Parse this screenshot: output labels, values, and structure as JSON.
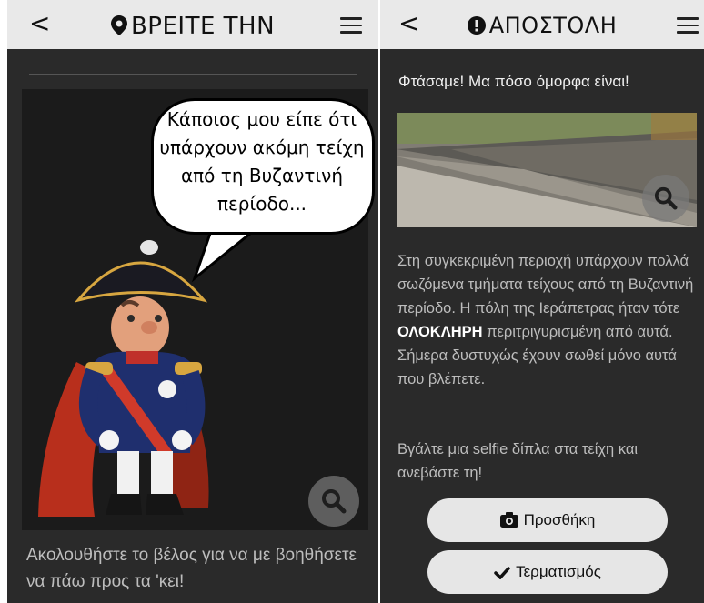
{
  "left_screen": {
    "header": {
      "back_label": "<",
      "title": "ΒΡΕΙΤΕ ΤΗΝ",
      "title_icon": "map-marker-icon",
      "menu_icon": "hamburger-menu-icon"
    },
    "speech_bubble": {
      "text": "Κάποιος μου είπε ότι υπάρχουν ακόμη τείχη από τη Βυζαντινή περίοδο..."
    },
    "zoom_icon": "magnifier-icon",
    "caption": "Ακολουθήστε το βέλος για να με βοηθήσετε να πάω προς τα 'κει!"
  },
  "right_screen": {
    "header": {
      "back_label": "<",
      "title": "ΑΠΟΣΤΟΛΗ",
      "title_icon": "exclamation-circle-icon",
      "menu_icon": "hamburger-menu-icon"
    },
    "mission_text": "Φτάσαμε! Μα πόσο όμορφα είναι!",
    "photo": {
      "zoom_icon": "magnifier-icon"
    },
    "body": {
      "part1": "Στη συγκεκριμένη περιοχή υπάρχουν πολλά σωζόμενα τμήματα τείχους από τη Βυζαντινή περίοδο. Η πόλη της Ιεράπετρας ήταν τότε ",
      "highlight": "ΟΛΟΚΛΗΡΗ",
      "part2": " περιτριγυρισμένη από αυτά. Σήμερα δυστυχώς έχουν σωθεί μόνο αυτά που βλέπετε."
    },
    "selfie_text": "Βγάλτε μια selfie δίπλα στα τείχη και ανεβάστε τη!",
    "add_button": {
      "label": "Προσθήκη",
      "icon": "camera-icon"
    },
    "finish_button": {
      "label": "Τερματισμός",
      "icon": "checkmark-icon"
    }
  },
  "colors": {
    "background": "#2a2a2a",
    "topbar": "#e9e9e9",
    "button": "#e6e6e6",
    "body_text": "#bdbdbd"
  }
}
